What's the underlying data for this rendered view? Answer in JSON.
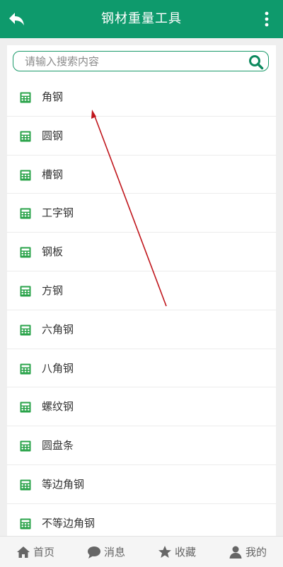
{
  "header": {
    "title": "钢材重量工具",
    "back_icon": "back-arrow-icon",
    "more_icon": "more-vertical-icon"
  },
  "search": {
    "placeholder": "请输入搜索内容",
    "value": ""
  },
  "list": {
    "items": [
      {
        "label": "角钢"
      },
      {
        "label": "圆钢"
      },
      {
        "label": "槽钢"
      },
      {
        "label": "工字钢"
      },
      {
        "label": "钢板"
      },
      {
        "label": "方钢"
      },
      {
        "label": "六角钢"
      },
      {
        "label": "八角钢"
      },
      {
        "label": "螺纹钢"
      },
      {
        "label": "圆盘条"
      },
      {
        "label": "等边角钢"
      },
      {
        "label": "不等边角钢"
      }
    ],
    "item_icon": "calculator-icon"
  },
  "tabbar": {
    "tabs": [
      {
        "label": "首页",
        "icon": "home-icon"
      },
      {
        "label": "消息",
        "icon": "chat-icon"
      },
      {
        "label": "收藏",
        "icon": "star-icon"
      },
      {
        "label": "我的",
        "icon": "user-icon"
      }
    ]
  },
  "colors": {
    "primary": "#0e9a6c",
    "icon_green": "#2aa34a",
    "annotation_red": "#c0161c"
  }
}
